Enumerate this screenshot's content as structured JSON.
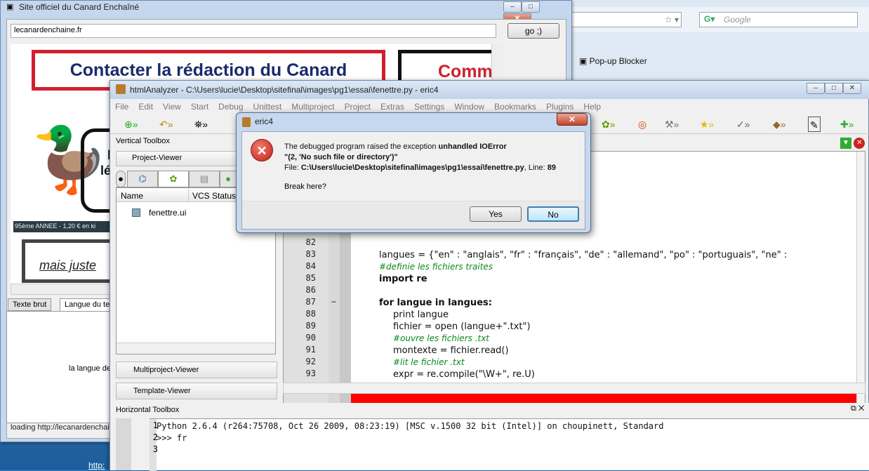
{
  "browser": {
    "search_placeholder": "Google",
    "popup_blocker": "Pop-up Blocker"
  },
  "left_window": {
    "title": "Site officiel du Canard Enchaîné",
    "url": "lecanardenchaine.fr",
    "go_label": "go ;)",
    "banner": "Contacter la rédaction du Canard",
    "banner2": "Comm",
    "text1": "l",
    "text2": "lé",
    "footer_strip": "95ème ANNEE - 1,20 € en ki",
    "mais": "mais juste",
    "tabs": [
      "Texte brut",
      "Langue du te"
    ],
    "lang_text": "la langue de",
    "status": "loading http://lecanardenchaii"
  },
  "eric": {
    "title": "htmlAnalyzer - C:\\Users\\lucie\\Desktop\\sitefinal\\images\\pg1\\essai\\fenettre.py - eric4",
    "menu": [
      "File",
      "Edit",
      "View",
      "Start",
      "Debug",
      "Unittest",
      "Multiproject",
      "Project",
      "Extras",
      "Settings",
      "Window",
      "Bookmarks",
      "Plugins",
      "Help"
    ],
    "vertical_toolbox": "Vertical Toolbox",
    "project_viewer": "Project-Viewer",
    "tree_headers": [
      "Name",
      "VCS Status"
    ],
    "tree_file": "fenettre.ui",
    "multiproject_viewer": "Multiproject-Viewer",
    "template_viewer": "Template-Viewer",
    "horizontal_toolbox": "Horizontal Toolbox",
    "code_lines": [
      {
        "n": "82",
        "text": ""
      },
      {
        "n": "83",
        "text": "langues = {\"en\" : \"anglais\", \"fr\" : \"français\", \"de\" : \"allemand\", \"po\" : \"portuguais\", \"ne\" :"
      },
      {
        "n": "84",
        "text": "#definie les fichiers traites"
      },
      {
        "n": "85",
        "text": "import re"
      },
      {
        "n": "86",
        "text": ""
      },
      {
        "n": "87",
        "text": "for langue in langues:"
      },
      {
        "n": "88",
        "text": "print langue"
      },
      {
        "n": "89",
        "text": "fichier = open (langue+\".txt\")"
      },
      {
        "n": "90",
        "text": "#ouvre les fichiers .txt"
      },
      {
        "n": "91",
        "text": "montexte = fichier.read()"
      },
      {
        "n": "92",
        "text": "#lit le fichier .txt"
      },
      {
        "n": "93",
        "text": "expr = re.compile(\"\\W+\", re.U)"
      }
    ],
    "fold_marker": "−",
    "shell_lines": [
      {
        "n": "1",
        "text": "Python 2.6.4 (r264:75708, Oct 26 2009, 08:23:19) [MSC v.1500 32 bit (Intel)] on choupinett, Standard"
      },
      {
        "n": "2",
        "text": ">>> fr"
      },
      {
        "n": "3",
        "text": ""
      }
    ]
  },
  "dialog": {
    "title": "eric4",
    "message_prefix": "The debugged program raised the exception ",
    "exception": "unhandled IOError",
    "detail": "\"(2, 'No such file or directory')\"",
    "file_prefix": "File: ",
    "file_path": "C:\\Users\\lucie\\Desktop\\sitefinal\\images\\pg1\\essai\\fenettre.py",
    "line_prefix": ", Line: ",
    "line": "89",
    "question": "Break here?",
    "yes_label": "Yes",
    "no_label": "No"
  },
  "bottom_link": "http:"
}
